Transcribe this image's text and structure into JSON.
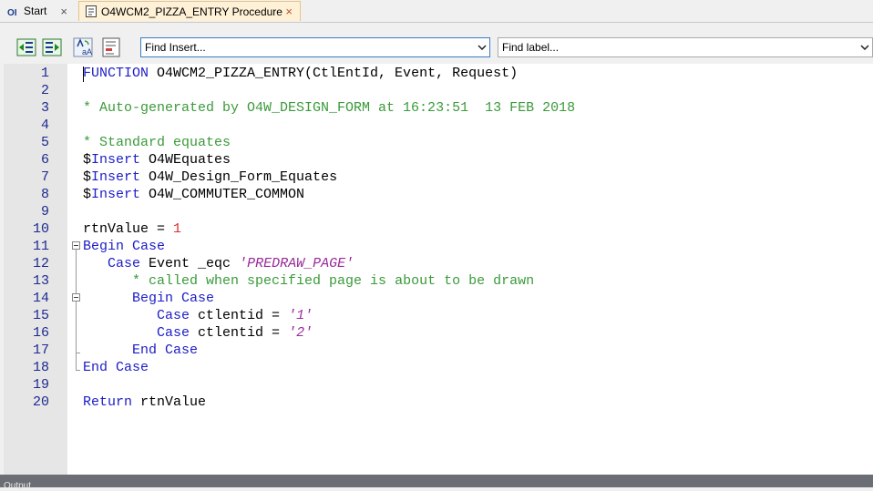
{
  "tabs": [
    {
      "label": "Start",
      "icon": "oi-logo-icon",
      "close": "×"
    },
    {
      "label": "O4WCM2_PIZZA_ENTRY Procedure",
      "icon": "procedure-icon",
      "close": "×"
    }
  ],
  "toolbar": {
    "find_insert": "Find Insert...",
    "find_label": "Find label..."
  },
  "lines": [
    {
      "n": "1",
      "segs": [
        [
          "kw",
          "FUNCTION"
        ],
        [
          "pl",
          " O4WCM2_PIZZA_ENTRY(CtlEntId, Event, Request)"
        ]
      ]
    },
    {
      "n": "2",
      "segs": []
    },
    {
      "n": "3",
      "segs": [
        [
          "cm",
          "* Auto-generated by O4W_DESIGN_FORM at 16:23:51  13 FEB 2018"
        ]
      ]
    },
    {
      "n": "4",
      "segs": []
    },
    {
      "n": "5",
      "segs": [
        [
          "cm",
          "* Standard equates"
        ]
      ]
    },
    {
      "n": "6",
      "segs": [
        [
          "pl",
          "$"
        ],
        [
          "kw",
          "Insert"
        ],
        [
          "pl",
          " O4WEquates"
        ]
      ]
    },
    {
      "n": "7",
      "segs": [
        [
          "pl",
          "$"
        ],
        [
          "kw",
          "Insert"
        ],
        [
          "pl",
          " O4W_Design_Form_Equates"
        ]
      ]
    },
    {
      "n": "8",
      "segs": [
        [
          "pl",
          "$"
        ],
        [
          "kw",
          "Insert"
        ],
        [
          "pl",
          " O4W_COMMUTER_COMMON"
        ]
      ]
    },
    {
      "n": "9",
      "segs": []
    },
    {
      "n": "10",
      "segs": [
        [
          "pl",
          "rtnValue = "
        ],
        [
          "num",
          "1"
        ]
      ]
    },
    {
      "n": "11",
      "segs": [
        [
          "kw",
          "Begin Case"
        ]
      ]
    },
    {
      "n": "12",
      "segs": [
        [
          "pl",
          "   "
        ],
        [
          "kw",
          "Case"
        ],
        [
          "pl",
          " Event _eqc "
        ],
        [
          "str",
          "'PREDRAW_PAGE'"
        ]
      ]
    },
    {
      "n": "13",
      "segs": [
        [
          "pl",
          "      "
        ],
        [
          "cm",
          "* called when specified page is about to be drawn"
        ]
      ]
    },
    {
      "n": "14",
      "segs": [
        [
          "pl",
          "      "
        ],
        [
          "kw",
          "Begin Case"
        ]
      ]
    },
    {
      "n": "15",
      "segs": [
        [
          "pl",
          "         "
        ],
        [
          "kw",
          "Case"
        ],
        [
          "pl",
          " ctlentid = "
        ],
        [
          "str",
          "'1'"
        ]
      ]
    },
    {
      "n": "16",
      "segs": [
        [
          "pl",
          "         "
        ],
        [
          "kw",
          "Case"
        ],
        [
          "pl",
          " ctlentid = "
        ],
        [
          "str",
          "'2'"
        ]
      ]
    },
    {
      "n": "17",
      "segs": [
        [
          "pl",
          "      "
        ],
        [
          "kw",
          "End Case"
        ]
      ]
    },
    {
      "n": "18",
      "segs": [
        [
          "kw",
          "End Case"
        ]
      ]
    },
    {
      "n": "19",
      "segs": []
    },
    {
      "n": "20",
      "segs": [
        [
          "kw",
          "Return"
        ],
        [
          "pl",
          " rtnValue"
        ]
      ]
    }
  ],
  "colors": {
    "keyword": "#1d1dc8",
    "comment": "#3a9a3a",
    "string": "#9a2a9a",
    "number": "#d83030",
    "line_number": "#1c2a90",
    "gutter": "#e6e6e6"
  },
  "status_bar": "Output"
}
